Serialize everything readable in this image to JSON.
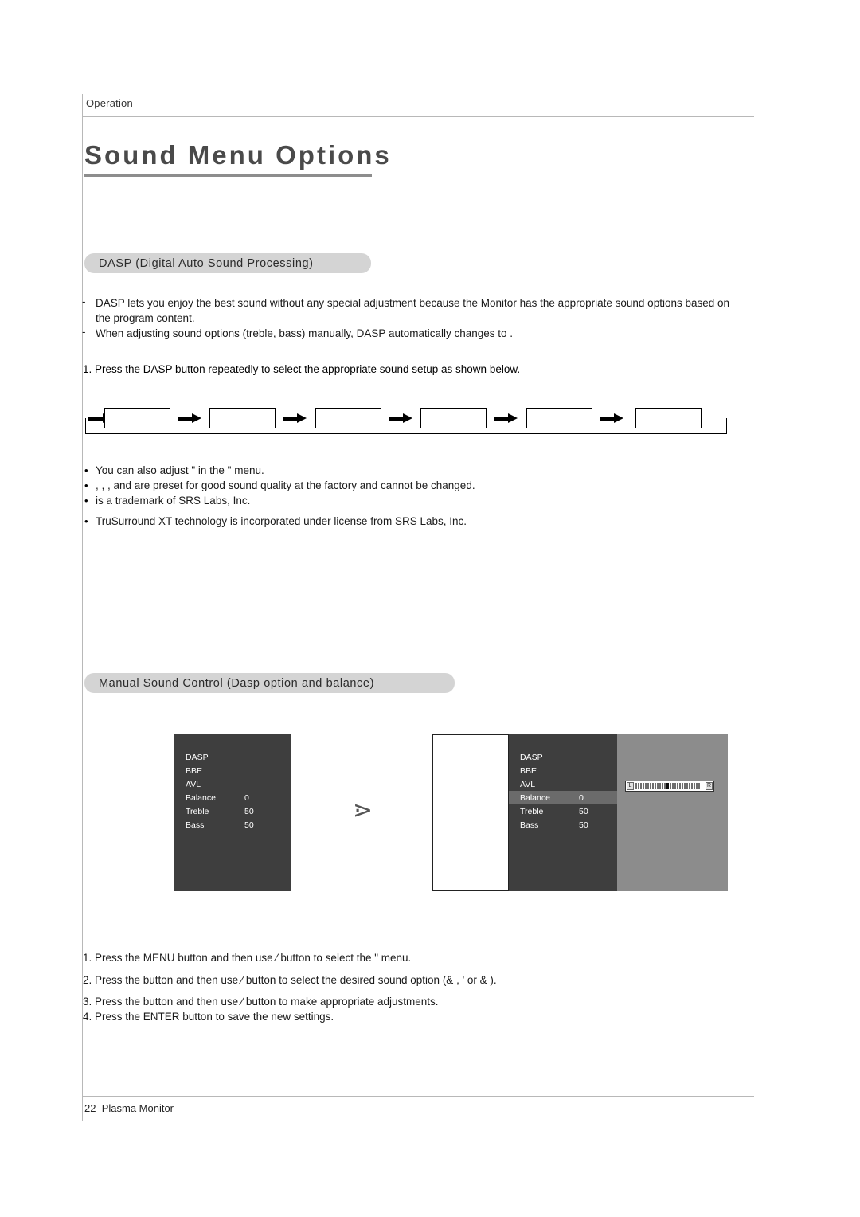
{
  "header": {
    "section_label": "Operation"
  },
  "title": "Sound Menu Options",
  "dasp_section": {
    "heading": "DASP (Digital Auto Sound Processing)",
    "dash": "-",
    "para1": "DASP lets you enjoy the best sound without any special adjustment because the Monitor has the appropriate sound options based on the program content.",
    "para2": "When adjusting sound options (treble, bass) manually, DASP automatically changes to    .",
    "step1": "1. Press the DASP button repeatedly to select the appropriate sound setup as shown below.",
    "flow_boxes": [
      "",
      "",
      "",
      "",
      "",
      ""
    ],
    "bullet_char": "•",
    "bullets": [
      "You can also adjust \"        in the    \"      menu.",
      "            ,         ,              , and               are preset for good sound quality at the factory and cannot be changed.",
      "               is a trademark of SRS Labs, Inc.",
      "TruSurround XT technology is incorporated under license from SRS Labs, Inc."
    ]
  },
  "manual_section": {
    "heading": "Manual Sound Control (Dasp         option and balance)",
    "osd_left": {
      "rows": [
        {
          "label": "DASP",
          "value": ""
        },
        {
          "label": "BBE",
          "value": ""
        },
        {
          "label": "AVL",
          "value": ""
        },
        {
          "label": "Balance",
          "value": "0"
        },
        {
          "label": "Treble",
          "value": "50"
        },
        {
          "label": "Bass",
          "value": "50"
        }
      ]
    },
    "transition_icon": "⋗",
    "osd_right": {
      "rows": [
        {
          "label": "DASP",
          "value": ""
        },
        {
          "label": "BBE",
          "value": ""
        },
        {
          "label": "AVL",
          "value": ""
        },
        {
          "label": "Balance",
          "value": "0"
        },
        {
          "label": "Treble",
          "value": "50"
        },
        {
          "label": "Bass",
          "value": "50"
        }
      ],
      "selected_index": 3,
      "balance_slider": {
        "left_label": "L",
        "right_label": "R",
        "value": 0
      }
    },
    "steps": [
      "1. Press the MENU button and then use   ⁄   button to select the  \"      menu.",
      "2. Press the      button and then use    ⁄    button to select the desired sound option (&           , '       or &     ).",
      "3. Press the      button and then use    ⁄    button to make appropriate adjustments.",
      "4. Press the ENTER button to save the new settings."
    ]
  },
  "footer": {
    "page_number": "22",
    "product": "Plasma Monitor"
  }
}
